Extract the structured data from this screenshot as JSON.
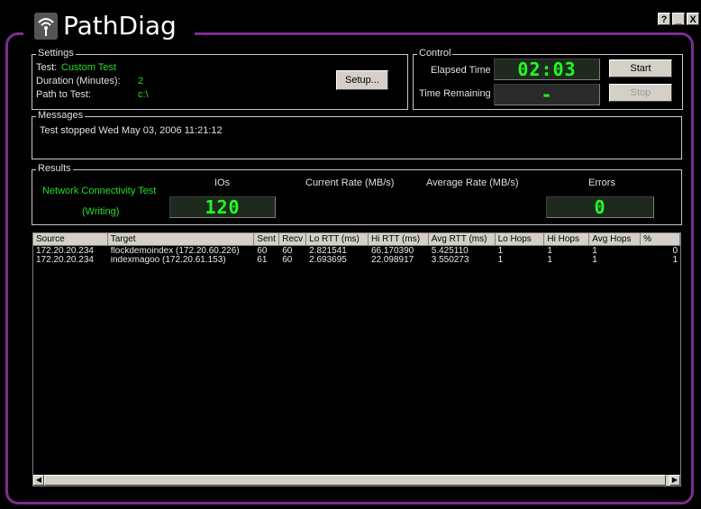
{
  "app": {
    "title": "PathDiag",
    "icon": "wifi-signal-icon"
  },
  "window_buttons": [
    "?",
    "_",
    "X"
  ],
  "settings": {
    "group_label": "Settings",
    "test_label": "Test:",
    "test_value": "Custom Test",
    "duration_label": "Duration (Minutes):",
    "duration_value": "2",
    "path_label": "Path to Test:",
    "path_value": "c:\\",
    "setup_button": "Setup..."
  },
  "control": {
    "group_label": "Control",
    "elapsed_label": "Elapsed Time",
    "elapsed_value": "02:03",
    "remaining_label": "Time Remaining",
    "remaining_value": "-",
    "start_button": "Start",
    "stop_button": "Stop"
  },
  "messages": {
    "group_label": "Messages",
    "text": "Test stopped Wed May 03, 2006 11:21:12"
  },
  "results": {
    "group_label": "Results",
    "test_name": "Network Connectivity Test",
    "mode": "(Writing)",
    "ios_label": "IOs",
    "ios_value": "120",
    "current_rate_label": "Current Rate (MB/s)",
    "average_rate_label": "Average Rate (MB/s)",
    "errors_label": "Errors",
    "errors_value": "0"
  },
  "table": {
    "columns": [
      "Source",
      "Target",
      "Sent",
      "Recv",
      "Lo RTT (ms)",
      "Hi RTT (ms)",
      "Avg RTT (ms)",
      "Lo Hops",
      "Hi Hops",
      "Avg Hops",
      "%"
    ],
    "rows": [
      [
        "172.20.20.234",
        "flockdemoindex (172.20.60.226)",
        "60",
        "60",
        "2.821541",
        "66.170390",
        "5.425110",
        "1",
        "1",
        "1",
        "0"
      ],
      [
        "172.20.20.234",
        "indexmagoo (172.20.61.153)",
        "61",
        "60",
        "2.693695",
        "22.098917",
        "3.550273",
        "1",
        "1",
        "1",
        "1"
      ]
    ]
  },
  "colors": {
    "frame": "#7b2d8e",
    "lcd_green": "#20ff20",
    "label_green": "#22e022",
    "background": "#000000"
  }
}
